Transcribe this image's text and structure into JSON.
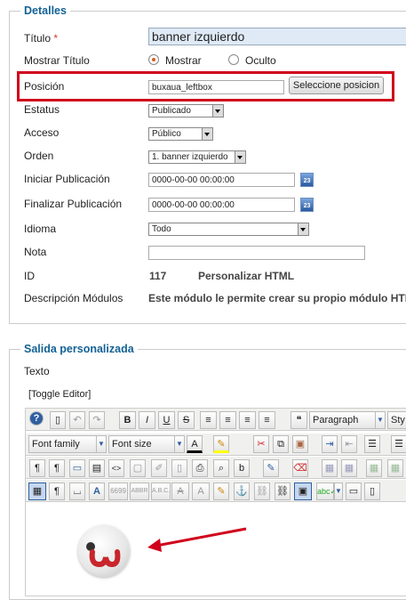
{
  "details": {
    "legend": "Detalles",
    "title_label": "Título",
    "title_required": "*",
    "title_value": "banner izquierdo",
    "show_title_label": "Mostrar Título",
    "show_option": "Mostrar",
    "hide_option": "Oculto",
    "position_label": "Posición",
    "position_value": "buxaua_leftbox",
    "select_position_button": "Seleccione posicion",
    "status_label": "Estatus",
    "status_value": "Publicado",
    "access_label": "Acceso",
    "access_value": "Público",
    "order_label": "Orden",
    "order_value": "1. banner izquierdo",
    "start_label": "Iniciar Publicación",
    "start_value": "0000-00-00 00:00:00",
    "finish_label": "Finalizar Publicación",
    "finish_value": "0000-00-00 00:00:00",
    "language_label": "Idioma",
    "language_value": "Todo",
    "note_label": "Nota",
    "note_value": "",
    "id_label": "ID",
    "id_value": "117",
    "module_type": "Personalizar HTML",
    "description_label": "Descripción Módulos",
    "description_value": "Este módulo le permite crear su propio módulo HTM",
    "calendar_day": "23"
  },
  "output": {
    "legend": "Salida personalizada",
    "text_label": "Texto",
    "toggle_editor": "[Toggle Editor]",
    "paragraph_select": "Paragraph",
    "style_select": "Sty",
    "font_family_select": "Font family",
    "font_size_select": "Font size"
  },
  "colors": {
    "highlight_border": "#d0021b",
    "arrow": "#d0021b",
    "legend": "#146295"
  }
}
